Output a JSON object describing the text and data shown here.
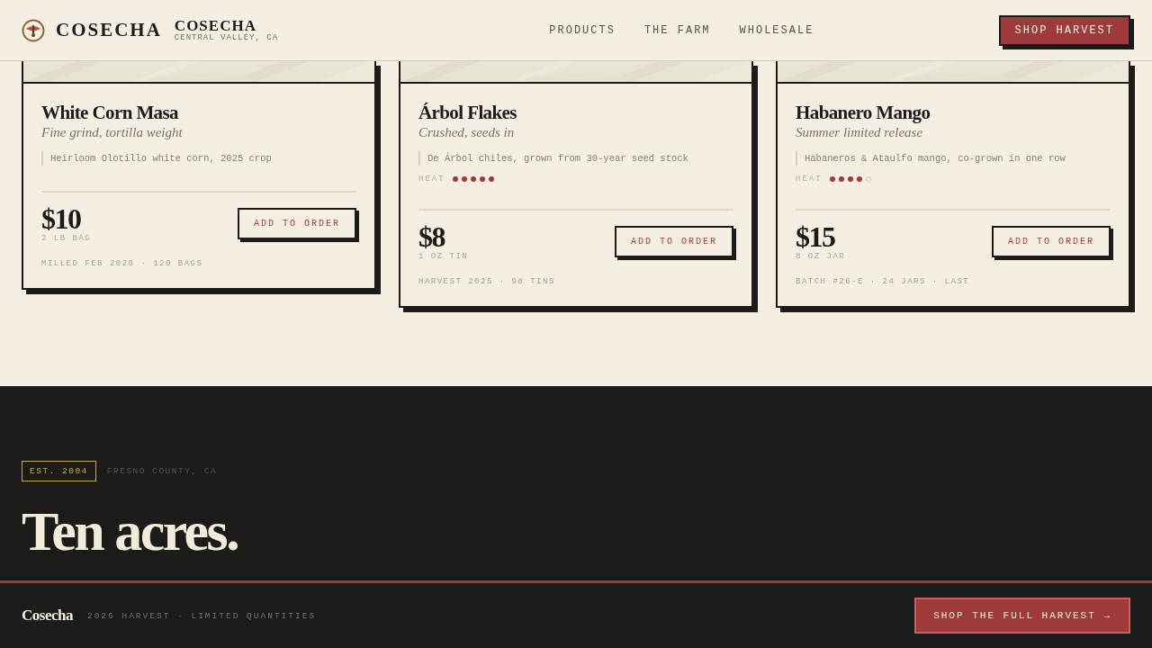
{
  "header": {
    "brand": "COSECHA",
    "brand_title": "COSECHA",
    "brand_subtitle": "CENTRAL VALLEY, CA",
    "nav": [
      "PRODUCTS",
      "THE FARM",
      "WHOLESALE"
    ],
    "cta": "SHOP HARVEST"
  },
  "products": [
    {
      "name": "White Corn Masa",
      "subtitle": "Fine grind, tortilla weight",
      "note": "Heirloom Olotillo white corn, 2025 crop",
      "price": "$10",
      "unit": "2 LB BAG",
      "meta": "MILLED FEB 2026 · 120 BAGS",
      "button": "ADD TO ORDER"
    },
    {
      "name": "Árbol Flakes",
      "subtitle": "Crushed, seeds in",
      "note": "De Árbol chiles, grown from 30-year seed stock",
      "heat_label": "HEAT",
      "stars": 5,
      "price": "$8",
      "unit": "1 OZ TIN",
      "meta": "HARVEST 2025 · 98 TINS",
      "button": "ADD TO ORDER"
    },
    {
      "name": "Habanero Mango",
      "subtitle": "Summer limited release",
      "note": "Habaneros & Ataulfo mango, co-grown in one row",
      "heat_label": "HEAT",
      "stars": 4,
      "price": "$15",
      "unit": "8 OZ JAR",
      "meta": "BATCH #26-E · 24 JARS · LAST",
      "button": "ADD TO ORDER"
    }
  ],
  "story": {
    "badge": "EST. 2004",
    "location": "FRESNO COUNTY, CA",
    "headline": [
      "Ten acres."
    ]
  },
  "footer_bar": {
    "brand": "Cosecha",
    "tagline": "2026 HARVEST · LIMITED QUANTITIES",
    "cta": "SHOP THE FULL HARVEST →"
  }
}
